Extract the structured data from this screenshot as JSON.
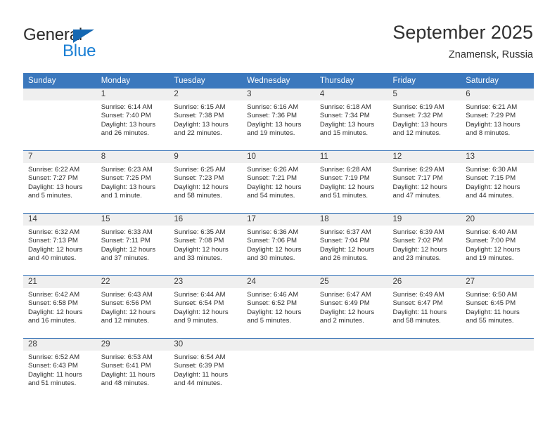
{
  "brand": {
    "name_top": "General",
    "name_bottom": "Blue",
    "accent_color": "#1a7fd4",
    "triangle_color": "#1568b2"
  },
  "header": {
    "title": "September 2025",
    "subtitle": "Znamensk, Russia"
  },
  "calendar": {
    "header_bg": "#3b78bd",
    "row_divider_color": "#2d6cb3",
    "daynum_band_bg": "#efefef",
    "weekday_headers": [
      "Sunday",
      "Monday",
      "Tuesday",
      "Wednesday",
      "Thursday",
      "Friday",
      "Saturday"
    ],
    "weeks": [
      [
        {
          "day": "",
          "empty": true,
          "sunrise": "",
          "sunset": "",
          "daylight_line1": "",
          "daylight_line2": ""
        },
        {
          "day": "1",
          "sunrise": "Sunrise: 6:14 AM",
          "sunset": "Sunset: 7:40 PM",
          "daylight_line1": "Daylight: 13 hours",
          "daylight_line2": "and 26 minutes."
        },
        {
          "day": "2",
          "sunrise": "Sunrise: 6:15 AM",
          "sunset": "Sunset: 7:38 PM",
          "daylight_line1": "Daylight: 13 hours",
          "daylight_line2": "and 22 minutes."
        },
        {
          "day": "3",
          "sunrise": "Sunrise: 6:16 AM",
          "sunset": "Sunset: 7:36 PM",
          "daylight_line1": "Daylight: 13 hours",
          "daylight_line2": "and 19 minutes."
        },
        {
          "day": "4",
          "sunrise": "Sunrise: 6:18 AM",
          "sunset": "Sunset: 7:34 PM",
          "daylight_line1": "Daylight: 13 hours",
          "daylight_line2": "and 15 minutes."
        },
        {
          "day": "5",
          "sunrise": "Sunrise: 6:19 AM",
          "sunset": "Sunset: 7:32 PM",
          "daylight_line1": "Daylight: 13 hours",
          "daylight_line2": "and 12 minutes."
        },
        {
          "day": "6",
          "sunrise": "Sunrise: 6:21 AM",
          "sunset": "Sunset: 7:29 PM",
          "daylight_line1": "Daylight: 13 hours",
          "daylight_line2": "and 8 minutes."
        }
      ],
      [
        {
          "day": "7",
          "sunrise": "Sunrise: 6:22 AM",
          "sunset": "Sunset: 7:27 PM",
          "daylight_line1": "Daylight: 13 hours",
          "daylight_line2": "and 5 minutes."
        },
        {
          "day": "8",
          "sunrise": "Sunrise: 6:23 AM",
          "sunset": "Sunset: 7:25 PM",
          "daylight_line1": "Daylight: 13 hours",
          "daylight_line2": "and 1 minute."
        },
        {
          "day": "9",
          "sunrise": "Sunrise: 6:25 AM",
          "sunset": "Sunset: 7:23 PM",
          "daylight_line1": "Daylight: 12 hours",
          "daylight_line2": "and 58 minutes."
        },
        {
          "day": "10",
          "sunrise": "Sunrise: 6:26 AM",
          "sunset": "Sunset: 7:21 PM",
          "daylight_line1": "Daylight: 12 hours",
          "daylight_line2": "and 54 minutes."
        },
        {
          "day": "11",
          "sunrise": "Sunrise: 6:28 AM",
          "sunset": "Sunset: 7:19 PM",
          "daylight_line1": "Daylight: 12 hours",
          "daylight_line2": "and 51 minutes."
        },
        {
          "day": "12",
          "sunrise": "Sunrise: 6:29 AM",
          "sunset": "Sunset: 7:17 PM",
          "daylight_line1": "Daylight: 12 hours",
          "daylight_line2": "and 47 minutes."
        },
        {
          "day": "13",
          "sunrise": "Sunrise: 6:30 AM",
          "sunset": "Sunset: 7:15 PM",
          "daylight_line1": "Daylight: 12 hours",
          "daylight_line2": "and 44 minutes."
        }
      ],
      [
        {
          "day": "14",
          "sunrise": "Sunrise: 6:32 AM",
          "sunset": "Sunset: 7:13 PM",
          "daylight_line1": "Daylight: 12 hours",
          "daylight_line2": "and 40 minutes."
        },
        {
          "day": "15",
          "sunrise": "Sunrise: 6:33 AM",
          "sunset": "Sunset: 7:11 PM",
          "daylight_line1": "Daylight: 12 hours",
          "daylight_line2": "and 37 minutes."
        },
        {
          "day": "16",
          "sunrise": "Sunrise: 6:35 AM",
          "sunset": "Sunset: 7:08 PM",
          "daylight_line1": "Daylight: 12 hours",
          "daylight_line2": "and 33 minutes."
        },
        {
          "day": "17",
          "sunrise": "Sunrise: 6:36 AM",
          "sunset": "Sunset: 7:06 PM",
          "daylight_line1": "Daylight: 12 hours",
          "daylight_line2": "and 30 minutes."
        },
        {
          "day": "18",
          "sunrise": "Sunrise: 6:37 AM",
          "sunset": "Sunset: 7:04 PM",
          "daylight_line1": "Daylight: 12 hours",
          "daylight_line2": "and 26 minutes."
        },
        {
          "day": "19",
          "sunrise": "Sunrise: 6:39 AM",
          "sunset": "Sunset: 7:02 PM",
          "daylight_line1": "Daylight: 12 hours",
          "daylight_line2": "and 23 minutes."
        },
        {
          "day": "20",
          "sunrise": "Sunrise: 6:40 AM",
          "sunset": "Sunset: 7:00 PM",
          "daylight_line1": "Daylight: 12 hours",
          "daylight_line2": "and 19 minutes."
        }
      ],
      [
        {
          "day": "21",
          "sunrise": "Sunrise: 6:42 AM",
          "sunset": "Sunset: 6:58 PM",
          "daylight_line1": "Daylight: 12 hours",
          "daylight_line2": "and 16 minutes."
        },
        {
          "day": "22",
          "sunrise": "Sunrise: 6:43 AM",
          "sunset": "Sunset: 6:56 PM",
          "daylight_line1": "Daylight: 12 hours",
          "daylight_line2": "and 12 minutes."
        },
        {
          "day": "23",
          "sunrise": "Sunrise: 6:44 AM",
          "sunset": "Sunset: 6:54 PM",
          "daylight_line1": "Daylight: 12 hours",
          "daylight_line2": "and 9 minutes."
        },
        {
          "day": "24",
          "sunrise": "Sunrise: 6:46 AM",
          "sunset": "Sunset: 6:52 PM",
          "daylight_line1": "Daylight: 12 hours",
          "daylight_line2": "and 5 minutes."
        },
        {
          "day": "25",
          "sunrise": "Sunrise: 6:47 AM",
          "sunset": "Sunset: 6:49 PM",
          "daylight_line1": "Daylight: 12 hours",
          "daylight_line2": "and 2 minutes."
        },
        {
          "day": "26",
          "sunrise": "Sunrise: 6:49 AM",
          "sunset": "Sunset: 6:47 PM",
          "daylight_line1": "Daylight: 11 hours",
          "daylight_line2": "and 58 minutes."
        },
        {
          "day": "27",
          "sunrise": "Sunrise: 6:50 AM",
          "sunset": "Sunset: 6:45 PM",
          "daylight_line1": "Daylight: 11 hours",
          "daylight_line2": "and 55 minutes."
        }
      ],
      [
        {
          "day": "28",
          "sunrise": "Sunrise: 6:52 AM",
          "sunset": "Sunset: 6:43 PM",
          "daylight_line1": "Daylight: 11 hours",
          "daylight_line2": "and 51 minutes."
        },
        {
          "day": "29",
          "sunrise": "Sunrise: 6:53 AM",
          "sunset": "Sunset: 6:41 PM",
          "daylight_line1": "Daylight: 11 hours",
          "daylight_line2": "and 48 minutes."
        },
        {
          "day": "30",
          "sunrise": "Sunrise: 6:54 AM",
          "sunset": "Sunset: 6:39 PM",
          "daylight_line1": "Daylight: 11 hours",
          "daylight_line2": "and 44 minutes."
        },
        {
          "day": "",
          "empty": true,
          "sunrise": "",
          "sunset": "",
          "daylight_line1": "",
          "daylight_line2": ""
        },
        {
          "day": "",
          "empty": true,
          "sunrise": "",
          "sunset": "",
          "daylight_line1": "",
          "daylight_line2": ""
        },
        {
          "day": "",
          "empty": true,
          "sunrise": "",
          "sunset": "",
          "daylight_line1": "",
          "daylight_line2": ""
        },
        {
          "day": "",
          "empty": true,
          "sunrise": "",
          "sunset": "",
          "daylight_line1": "",
          "daylight_line2": ""
        }
      ]
    ]
  }
}
